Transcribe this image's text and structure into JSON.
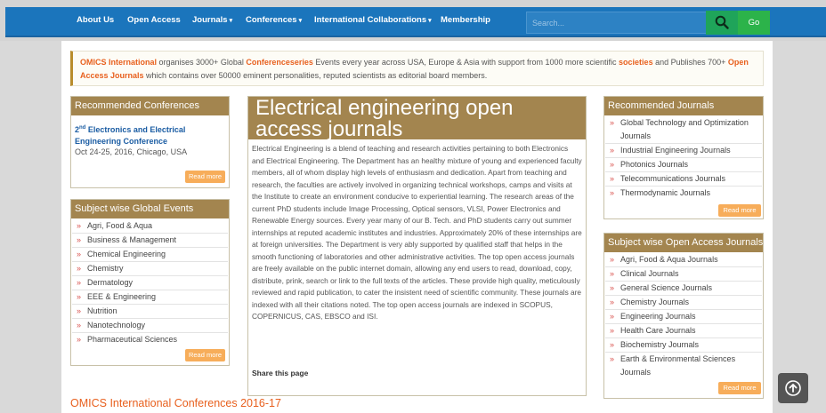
{
  "nav": {
    "items": [
      {
        "label": "About Us",
        "caret": false
      },
      {
        "label": "Open Access",
        "caret": false
      },
      {
        "label": "Journals",
        "caret": true
      },
      {
        "label": "Conferences",
        "caret": true
      },
      {
        "label": "International Collaborations",
        "caret": true
      },
      {
        "label": "Membership",
        "caret": false
      }
    ],
    "search_placeholder": "Search...",
    "search_icon": "search-icon",
    "go_label": "Go"
  },
  "notice": {
    "p1": "OMICS International",
    "p2": " organises 3000+ Global ",
    "p3": "Conferenceseries",
    "p4": " Events every year across USA, Europe & Asia with support from 1000 more scientific ",
    "p5": "societies",
    "p6": " and Publishes 700+ ",
    "p7": "Open Access Journals",
    "p8": " which contains over 50000 eminent personalities, reputed scientists as editorial board members."
  },
  "recommended_conferences": {
    "heading": "Recommended Conferences",
    "title_num": "2",
    "title_sup": "nd",
    "title_rest": " Electronics and Electrical Engineering Conference",
    "date": "Oct 24-25, 2016, Chicago, USA",
    "read_more": "Read more"
  },
  "subject_events": {
    "heading": "Subject wise Global Events",
    "items": [
      "Agri, Food & Aqua",
      "Business & Management",
      "Chemical Engineering",
      "Chemistry",
      "Dermatology",
      "EEE & Engineering",
      "Nutrition",
      "Nanotechnology",
      "Pharmaceutical Sciences"
    ],
    "read_more": "Read more"
  },
  "main": {
    "heading": "Electrical engineering open access journals",
    "body": "Electrical Engineering is a blend of teaching and research activities pertaining to both Electronics and Electrical Engineering. The Department has an healthy mixture of young and experienced faculty members, all of whom display high levels of enthusiasm and dedication. Apart from teaching and research, the faculties are actively involved in organizing technical workshops, camps and visits at the Institute to create an environment conducive to experiential learning. The research areas of the current PhD students include Image Processing, Optical sensors, VLSI, Power Electronics and Renewable Energy sources. Every year many of our B. Tech. and PhD students carry out summer internships at reputed academic institutes and industries. Approximately 20% of these internships are at foreign universities. The Department is very ably supported by qualified staff that helps in the smooth functioning of laboratories and other administrative activities. The top open access journals are freely available on the public internet domain, allowing any end users to read, download, copy, distribute, prink, search or link to the full texts of the articles. These provide high quality, meticulously reviewed and rapid publication, to cater the insistent need of scientific community. These journals are indexed with all their citations noted. The top open access journals are indexed in SCOPUS, COPERNICUS, CAS, EBSCO and ISI.",
    "share": "Share this page"
  },
  "recommended_journals": {
    "heading": "Recommended Journals",
    "items": [
      "Global Technology and Optimization Journals",
      "Industrial Engineering Journals",
      "Photonics Journals",
      "Telecommunications Journals",
      "Thermodynamic Journals"
    ],
    "read_more": "Read more"
  },
  "subject_journals": {
    "heading": "Subject wise Open Access Journals",
    "items": [
      "Agri, Food & Aqua Journals",
      "Clinical Journals",
      "General Science Journals",
      "Chemistry Journals",
      "Engineering Journals",
      "Health Care Journals",
      "Biochemistry Journals",
      "Earth & Environmental Sciences Journals"
    ],
    "read_more": "Read more"
  },
  "footer": {
    "title": "OMICS International Conferences 2016-17"
  },
  "colors": {
    "nav_blue": "#1b75bc",
    "box_head": "#a3854f",
    "accent_orange": "#e8601e",
    "read_more": "#f7ad5a",
    "link_blue": "#1a5ca3",
    "go_green": "#2cb34a"
  },
  "icons": {
    "bullet": "double-arrow-bullet-icon",
    "back_to_top": "arrow-up-icon"
  }
}
